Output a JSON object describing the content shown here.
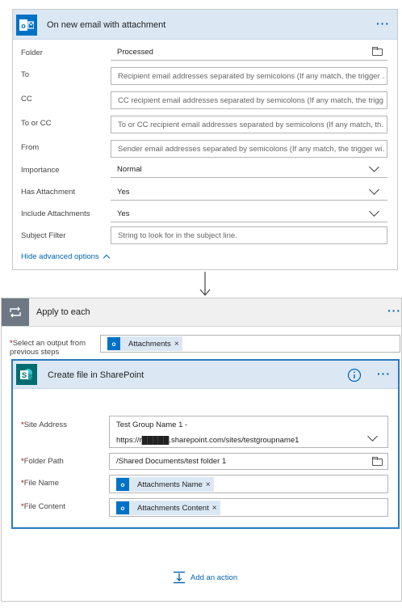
{
  "trigger": {
    "title": "On new email with attachment",
    "more_icon": "more-dots-icon",
    "fields": [
      {
        "label": "Folder",
        "value": "Processed"
      },
      {
        "label": "To",
        "placeholder": "Recipient email addresses separated by semicolons (If any match, the trigger …"
      },
      {
        "label": "CC",
        "placeholder": "CC recipient email addresses separated by semicolons (If any match, the trigg…"
      },
      {
        "label": "To or CC",
        "placeholder": "To or CC recipient email addresses separated by semicolons (If any match, th…"
      },
      {
        "label": "From",
        "placeholder": "Sender email addresses separated by semicolons (If any match, the trigger wi…"
      },
      {
        "label": "Importance",
        "value": "Normal"
      },
      {
        "label": "Has Attachment",
        "value": "Yes"
      },
      {
        "label": "Include Attachments",
        "value": "Yes"
      },
      {
        "label": "Subject Filter",
        "placeholder": "String to look for in the subject line."
      }
    ],
    "hide_advanced": "Hide advanced options"
  },
  "apply_each": {
    "title": "Apply to each",
    "select_label": "Select an output from previous steps",
    "required_mark": "*",
    "token": "Attachments"
  },
  "sharepoint": {
    "title": "Create file in SharePoint",
    "fields": [
      {
        "label": "Site Address",
        "value_line1": "Test Group Name 1 -",
        "value_line2": "https://r█████.sharepoint.com/sites/testgroupname1"
      },
      {
        "label": "Folder Path",
        "value": "/Shared Documents/test folder 1"
      },
      {
        "label": "File Name",
        "token": "Attachments Name"
      },
      {
        "label": "File Content",
        "token": "Attachments Content"
      }
    ]
  },
  "add_action": "Add an action",
  "colors": {
    "accent": "#0072c6",
    "header_bg": "#dbe8f4",
    "sharepoint": "#036c70",
    "loop": "#6d7883"
  }
}
